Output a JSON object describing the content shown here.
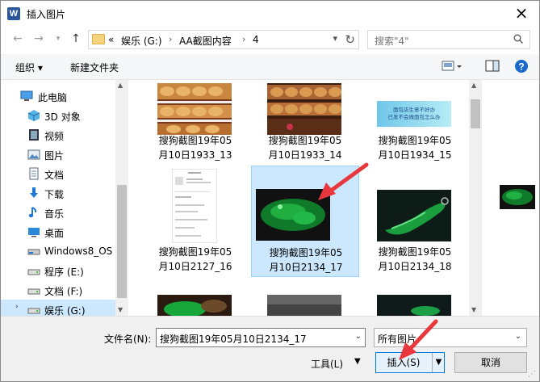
{
  "window": {
    "title": "插入图片",
    "app_icon_letter": "W"
  },
  "nav": {
    "breadcrumb": [
      "«",
      "娱乐 (G:)",
      "AA截图内容",
      "4"
    ],
    "search_placeholder": "搜索\"4\""
  },
  "toolbar": {
    "organize": "组织 ▾",
    "new_folder": "新建文件夹"
  },
  "sidebar": {
    "items": [
      {
        "label": "此电脑",
        "icon": "pc-icon"
      },
      {
        "label": "3D 对象",
        "icon": "3d-objects-icon"
      },
      {
        "label": "视频",
        "icon": "video-icon"
      },
      {
        "label": "图片",
        "icon": "pictures-icon"
      },
      {
        "label": "文档",
        "icon": "documents-icon"
      },
      {
        "label": "下载",
        "icon": "download-icon"
      },
      {
        "label": "音乐",
        "icon": "music-icon"
      },
      {
        "label": "桌面",
        "icon": "desktop-icon"
      },
      {
        "label": "Windows8_OS",
        "icon": "drive-icon"
      },
      {
        "label": "程序 (E:)",
        "icon": "drive-icon"
      },
      {
        "label": "文档 (F:)",
        "icon": "drive-icon"
      },
      {
        "label": "娱乐 (G:)",
        "icon": "drive-icon"
      }
    ]
  },
  "files": [
    {
      "line1": "搜狗截图19年05",
      "line2": "月10日1933_13",
      "kind": "bread"
    },
    {
      "line1": "搜狗截图19年05",
      "line2": "月10日1933_14",
      "kind": "bread2"
    },
    {
      "line1": "搜狗截图19年05",
      "line2": "月10日1934_15",
      "kind": "banner"
    },
    {
      "line1": "搜狗截图19年05",
      "line2": "月10日2127_16",
      "kind": "doc"
    },
    {
      "line1": "搜狗截图19年05",
      "line2": "月10日2134_17",
      "kind": "jade"
    },
    {
      "line1": "搜狗截图19年05",
      "line2": "月10日2134_18",
      "kind": "jade2"
    },
    {
      "line1": "",
      "line2": "",
      "kind": "jade3"
    },
    {
      "line1": "",
      "line2": "",
      "kind": "dark"
    },
    {
      "line1": "",
      "line2": "",
      "kind": "jade4"
    }
  ],
  "banner_text": {
    "line1": "面包店生意不好办",
    "line2": "已发不会做面包怎么办"
  },
  "bottom": {
    "filename_label": "文件名(N):",
    "filename_value": "搜狗截图19年05月10日2134_17",
    "filter_value": "所有图片",
    "tools_label": "工具(L)",
    "insert_label": "插入(S)",
    "cancel_label": "取消"
  },
  "colors": {
    "accent": "#0078d7",
    "selection": "#cce8ff",
    "annotation": "#e8383d"
  }
}
